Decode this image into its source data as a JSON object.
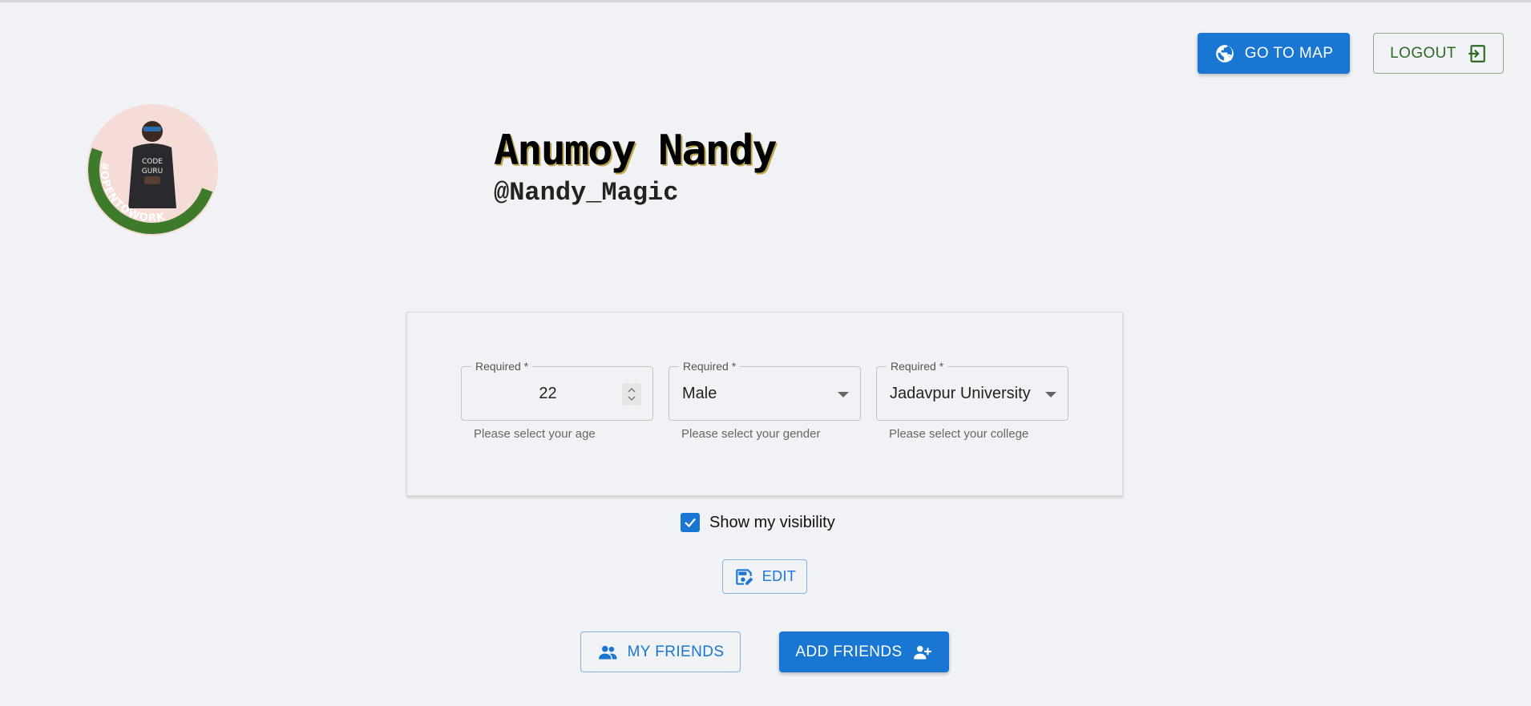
{
  "header": {
    "go_to_map_label": "GO TO MAP",
    "logout_label": "LOGOUT"
  },
  "profile": {
    "name": "Anumoy Nandy",
    "handle": "@Nandy_Magic",
    "avatar_badge_text": "#OPENTOWORK",
    "avatar_shirt_text": "CODE GURU"
  },
  "form": {
    "age": {
      "legend": "Required *",
      "value": "22",
      "helper": "Please select your age"
    },
    "gender": {
      "legend": "Required *",
      "value": "Male",
      "helper": "Please select your gender"
    },
    "college": {
      "legend": "Required *",
      "value": "Jadavpur University",
      "helper": "Please select your college"
    }
  },
  "visibility": {
    "label": "Show my visibility",
    "checked": true
  },
  "actions": {
    "edit_label": "EDIT",
    "my_friends_label": "MY FRIENDS",
    "add_friends_label": "ADD FRIENDS"
  },
  "colors": {
    "primary": "#1976d2",
    "logout_green": "#2e6a22",
    "background": "#f0f2f5",
    "badge_green": "#3d7a2a"
  }
}
